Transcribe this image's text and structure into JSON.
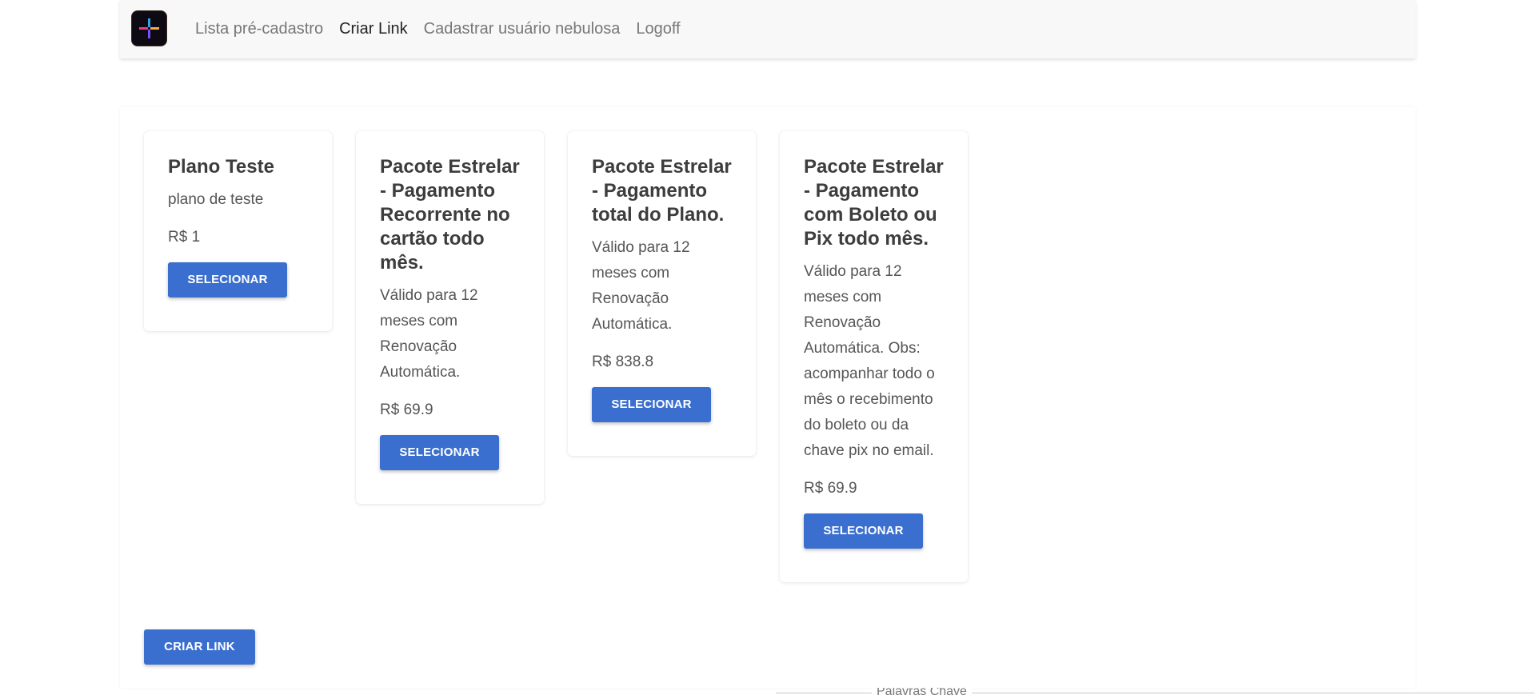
{
  "nav": {
    "logo_name": "brand-logo",
    "links": [
      {
        "label": "Lista pré-cadastro",
        "active": false
      },
      {
        "label": "Criar Link",
        "active": true
      },
      {
        "label": "Cadastrar usuário nebulosa",
        "active": false
      },
      {
        "label": "Logoff",
        "active": false
      }
    ]
  },
  "plans": [
    {
      "title": "Plano Teste",
      "description": "plano de teste",
      "price": "R$ 1",
      "button": "Selecionar"
    },
    {
      "title": "Pacote Estrelar - Pagamento Recorrente no cartão todo mês.",
      "description": "Válido para 12 meses com Renovação Automática.",
      "price": "R$ 69.9",
      "button": "Selecionar"
    },
    {
      "title": "Pacote Estrelar - Pagamento total do Plano.",
      "description": "Válido para 12 meses com Renovação Automática.",
      "price": "R$ 838.8",
      "button": "Selecionar"
    },
    {
      "title": "Pacote Estrelar - Pagamento com Boleto ou Pix todo mês.",
      "description": "Válido para 12 meses com Renovação Automática. Obs: acompanhar todo o mês o recebimento do boleto ou da chave pix no email.",
      "price": "R$ 69.9",
      "button": "Selecionar"
    }
  ],
  "actions": {
    "criar_link_label": "Criar Link"
  },
  "keywords": {
    "legend": "Palavras Chave"
  },
  "colors": {
    "primary": "#3a6fcf",
    "navbar_bg": "#f8f8f8"
  }
}
